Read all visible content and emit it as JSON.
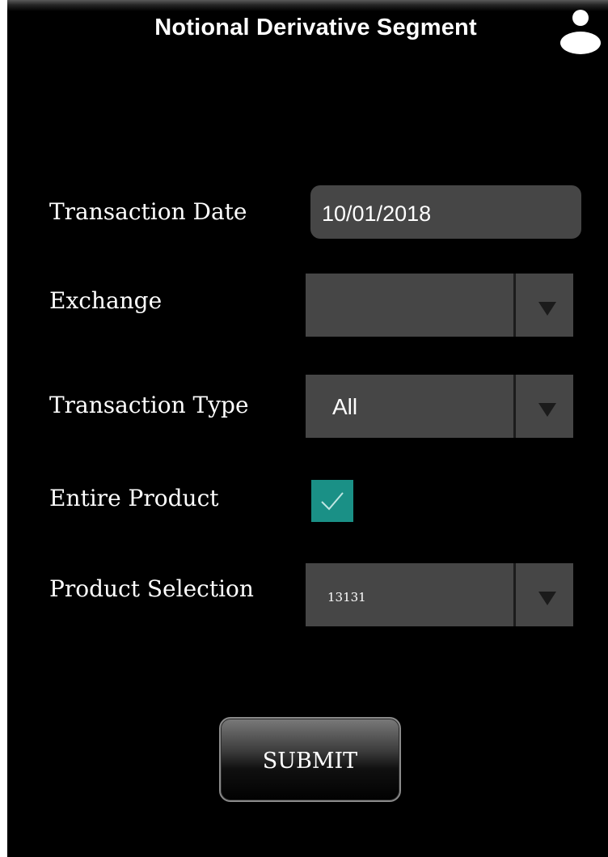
{
  "header": {
    "title": "Notional Derivative Segment"
  },
  "form": {
    "transaction_date": {
      "label": "Transaction Date",
      "value": "10/01/2018"
    },
    "exchange": {
      "label": "Exchange",
      "value": ""
    },
    "transaction_type": {
      "label": "Transaction Type",
      "value": "All"
    },
    "entire_product": {
      "label": "Entire Product",
      "checked": true
    },
    "product_selection": {
      "label": "Product Selection",
      "value": "13131"
    }
  },
  "submit_label": "SUBMIT",
  "icons": {
    "user": "user-icon",
    "dropdown_arrow": "chevron-down-icon",
    "check": "check-icon"
  },
  "colors": {
    "background": "#000000",
    "field": "#464646",
    "checkbox": "#1a9086"
  }
}
